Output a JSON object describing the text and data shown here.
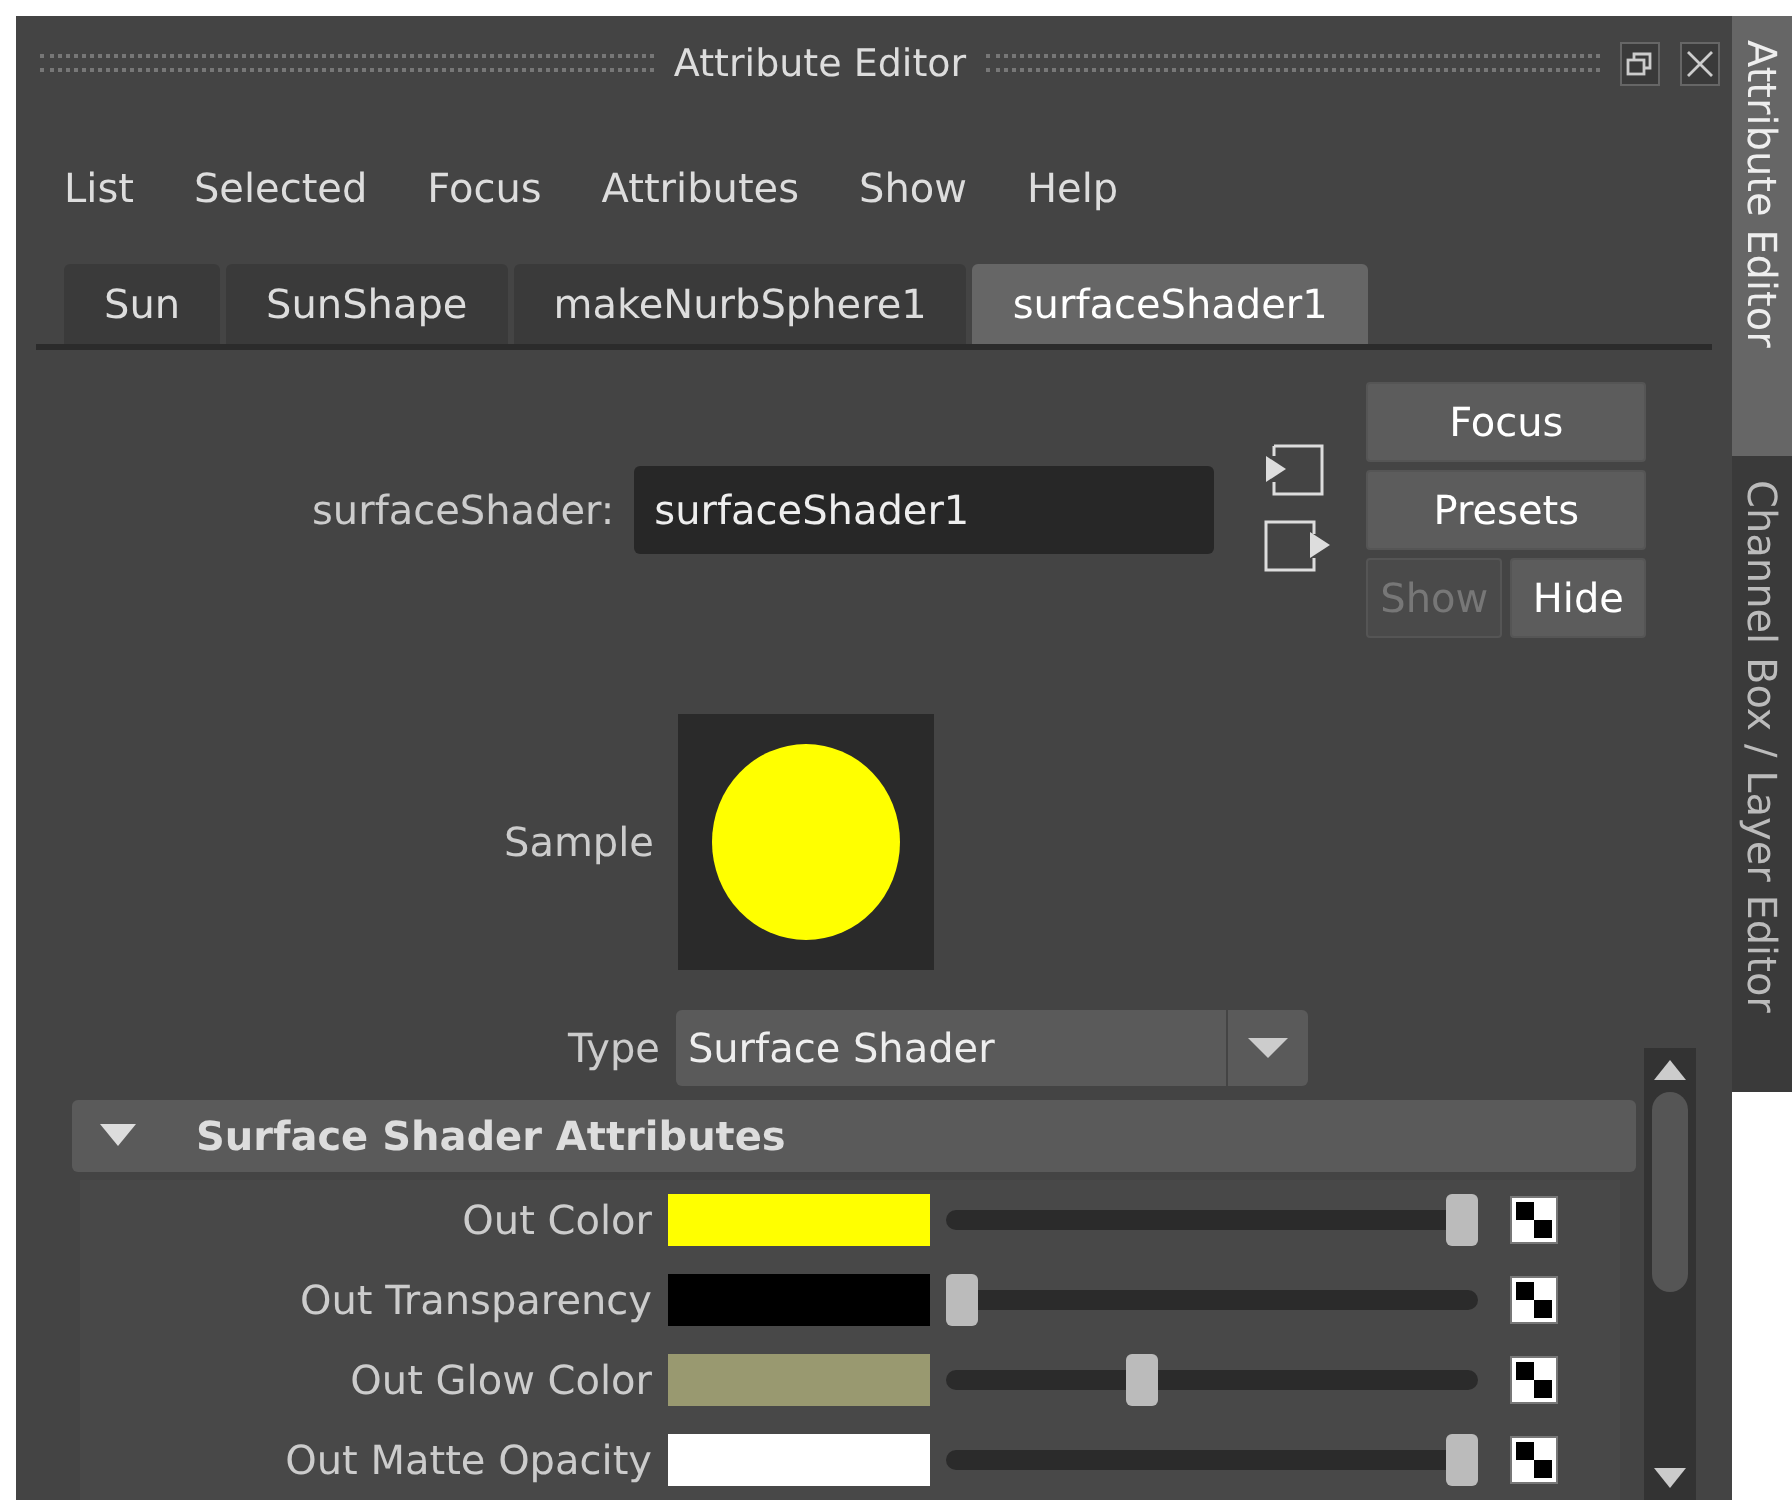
{
  "window": {
    "title": "Attribute Editor"
  },
  "menu": [
    "List",
    "Selected",
    "Focus",
    "Attributes",
    "Show",
    "Help"
  ],
  "tabs": [
    {
      "label": "Sun",
      "selected": false
    },
    {
      "label": "SunShape",
      "selected": false
    },
    {
      "label": "makeNurbSphere1",
      "selected": false
    },
    {
      "label": "surfaceShader1",
      "selected": true
    }
  ],
  "node": {
    "label": "surfaceShader:",
    "value": "surfaceShader1"
  },
  "buttons": [
    {
      "label": "Focus",
      "disabled": false
    },
    {
      "label": "Presets",
      "disabled": false
    }
  ],
  "show_hide": [
    {
      "label": "Show",
      "disabled": true
    },
    {
      "label": "Hide",
      "disabled": false
    }
  ],
  "sample": {
    "label": "Sample",
    "color": "#ffff00"
  },
  "type": {
    "label": "Type",
    "value": "Surface Shader"
  },
  "section": {
    "title": "Surface Shader Attributes",
    "expanded": true,
    "attributes": [
      {
        "label": "Out Color",
        "color": "#ffff00",
        "level": 1
      },
      {
        "label": "Out Transparency",
        "color": "#000000",
        "level": 0
      },
      {
        "label": "Out Glow Color",
        "color": "#999970",
        "level": 0.36
      },
      {
        "label": "Out Matte Opacity",
        "color": "#ffffff",
        "level": 1
      }
    ]
  },
  "side_tabs": [
    {
      "label": "Attribute Editor",
      "selected": true
    },
    {
      "label": "Channel Box / Layer Editor",
      "selected": false
    }
  ]
}
